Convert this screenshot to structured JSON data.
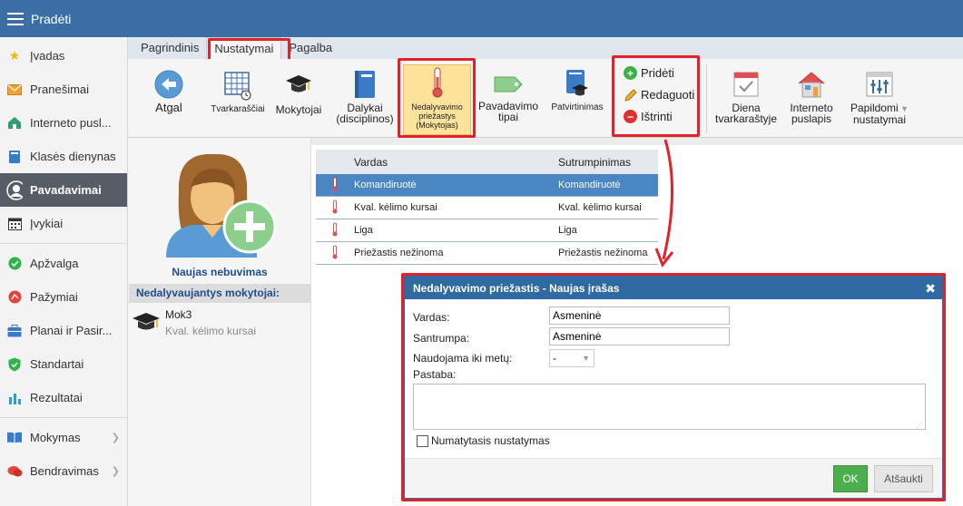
{
  "app": {
    "title": "Pradėti"
  },
  "sidebar": {
    "items": [
      {
        "label": "Įvadas",
        "icon": "star-icon",
        "color": "#f2b705"
      },
      {
        "label": "Pranešimai",
        "icon": "envelope-icon",
        "color": "#f0a030"
      },
      {
        "label": "Interneto pusl...",
        "icon": "home-icon",
        "color": "#2f9e6a"
      },
      {
        "label": "Klasės dienynas",
        "icon": "book-icon",
        "color": "#3a7bc8"
      },
      {
        "label": "Pavadavimai",
        "icon": "user-icon",
        "color": "#ffffff"
      },
      {
        "label": "Įvykiai",
        "icon": "calendar-icon",
        "color": "#333333"
      },
      {
        "label": "Apžvalga",
        "icon": "check-circle-icon",
        "color": "#2fb34a"
      },
      {
        "label": "Pažymiai",
        "icon": "badge-icon",
        "color": "#e0453a"
      },
      {
        "label": "Planai ir Pasir...",
        "icon": "briefcase-icon",
        "color": "#3a7bc8"
      },
      {
        "label": "Standartai",
        "icon": "shield-icon",
        "color": "#2fb34a"
      },
      {
        "label": "Rezultatai",
        "icon": "bar-chart-icon",
        "color": "#2a9fd6"
      },
      {
        "label": "Mokymas",
        "icon": "open-book-icon",
        "color": "#3a7bc8"
      },
      {
        "label": "Bendravimas",
        "icon": "chat-icon",
        "color": "#e0453a"
      }
    ]
  },
  "tabs": [
    "Pagrindinis",
    "Nustatymai",
    "Pagalba"
  ],
  "ribbon": {
    "back": "Atgal",
    "timetables": "Tvarkaraščiai",
    "teachers": "Mokytojai",
    "subjects_1": "Dalykai",
    "subjects_2": "(disciplinos)",
    "absence_1": "Nedalyvavimo",
    "absence_2": "priežastys",
    "absence_3": "(Mokytojas)",
    "subst_types_1": "Pavadavimo",
    "subst_types_2": "tipai",
    "confirmations": "Patvirtinimas",
    "add": "Pridėti",
    "edit": "Redaguoti",
    "delete": "Ištrinti",
    "day_1": "Diena",
    "day_2": "tvarkaraštyje",
    "website_1": "Interneto",
    "website_2": "puslapis",
    "extra_1": "Papildomi",
    "extra_2": "nustatymai"
  },
  "left_panel": {
    "new_absence": "Naujas nebuvimas",
    "section_title": "Nedalyvaujantys mokytojai:",
    "teacher_name": "Mok3",
    "teacher_reason": "Kval. kėlimo kursai"
  },
  "grid": {
    "headers": {
      "name": "Vardas",
      "abbr": "Sutrumpinimas"
    },
    "rows": [
      {
        "name": "Komandiruotė",
        "abbr": "Komandiruotė"
      },
      {
        "name": "Kval. kėlimo kursai",
        "abbr": "Kval. kėlimo kursai"
      },
      {
        "name": "Liga",
        "abbr": "Liga"
      },
      {
        "name": "Priežastis nežinoma",
        "abbr": "Priežastis nežinoma"
      }
    ]
  },
  "dialog": {
    "title": "Nedalyvavimo priežastis - Naujas įrašas",
    "name_label": "Vardas:",
    "name_value": "Asmeninė",
    "abbr_label": "Santrumpa:",
    "abbr_value": "Asmeninė",
    "used_until_label": "Naudojama iki metų:",
    "used_until_value": "-",
    "note_label": "Pastaba:",
    "default_label": "Numatytasis nustatymas",
    "ok": "OK",
    "cancel": "Atšaukti"
  },
  "colors": {
    "topbar": "#3a6ea5",
    "highlight": "#e0222a",
    "selected_row": "#4a86c1",
    "ok": "#4cae4c"
  }
}
